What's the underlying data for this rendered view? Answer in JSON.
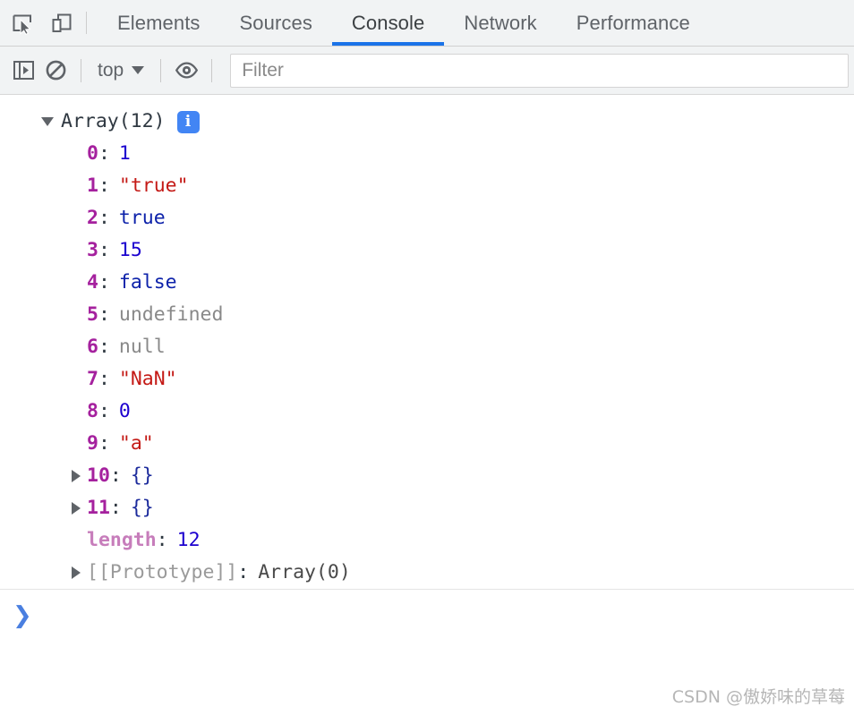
{
  "tabbar": {
    "icons": [
      {
        "name": "inspect-element-icon",
        "label": "Inspect element"
      },
      {
        "name": "device-toolbar-icon",
        "label": "Toggle device toolbar"
      }
    ],
    "tabs": [
      {
        "label": "Elements",
        "active": false
      },
      {
        "label": "Sources",
        "active": false
      },
      {
        "label": "Console",
        "active": true
      },
      {
        "label": "Network",
        "active": false
      },
      {
        "label": "Performance",
        "active": false
      }
    ],
    "active_tab_underline_color": "#1a73e8"
  },
  "toolbar": {
    "sidebar_toggle_icon": "console-sidebar-icon",
    "clear_console_icon": "clear-console-icon",
    "context_label": "top",
    "context_caret_icon": "chevron-down-icon",
    "live_expression_icon": "eye-icon",
    "filter_placeholder": "Filter",
    "filter_value": ""
  },
  "console": {
    "group": {
      "expanded": true,
      "title": "Array(12)",
      "info_badge": "i",
      "info_badge_color": "#4285f4"
    },
    "entries": [
      {
        "expandable": false,
        "key": "0",
        "key_style": "index",
        "value": "1",
        "value_type": "number"
      },
      {
        "expandable": false,
        "key": "1",
        "key_style": "index",
        "value": "\"true\"",
        "value_type": "string"
      },
      {
        "expandable": false,
        "key": "2",
        "key_style": "index",
        "value": "true",
        "value_type": "boolean"
      },
      {
        "expandable": false,
        "key": "3",
        "key_style": "index",
        "value": "15",
        "value_type": "number"
      },
      {
        "expandable": false,
        "key": "4",
        "key_style": "index",
        "value": "false",
        "value_type": "boolean"
      },
      {
        "expandable": false,
        "key": "5",
        "key_style": "index",
        "value": "undefined",
        "value_type": "nullish"
      },
      {
        "expandable": false,
        "key": "6",
        "key_style": "index",
        "value": "null",
        "value_type": "nullish"
      },
      {
        "expandable": false,
        "key": "7",
        "key_style": "index",
        "value": "\"NaN\"",
        "value_type": "string"
      },
      {
        "expandable": false,
        "key": "8",
        "key_style": "index",
        "value": "0",
        "value_type": "number"
      },
      {
        "expandable": false,
        "key": "9",
        "key_style": "index",
        "value": "\"a\"",
        "value_type": "string"
      },
      {
        "expandable": true,
        "key": "10",
        "key_style": "index",
        "value": "{}",
        "value_type": "object"
      },
      {
        "expandable": true,
        "key": "11",
        "key_style": "index",
        "value": "{}",
        "value_type": "object"
      },
      {
        "expandable": false,
        "key": "length",
        "key_style": "soft",
        "value": "12",
        "value_type": "number"
      },
      {
        "expandable": true,
        "key": "[[Prototype]]",
        "key_style": "proto",
        "value": "Array(0)",
        "value_type": "proto"
      }
    ],
    "colors": {
      "index_key": "#a5219e",
      "length_key": "#c77dbb",
      "number": "#1c00cf",
      "string": "#c41a16",
      "boolean": "#0d22aa",
      "nullish": "#898989",
      "object": "#1c2b9c"
    }
  },
  "prompt": {
    "chevron": "❯"
  },
  "watermark": {
    "text": "CSDN @傲娇味的草莓"
  }
}
